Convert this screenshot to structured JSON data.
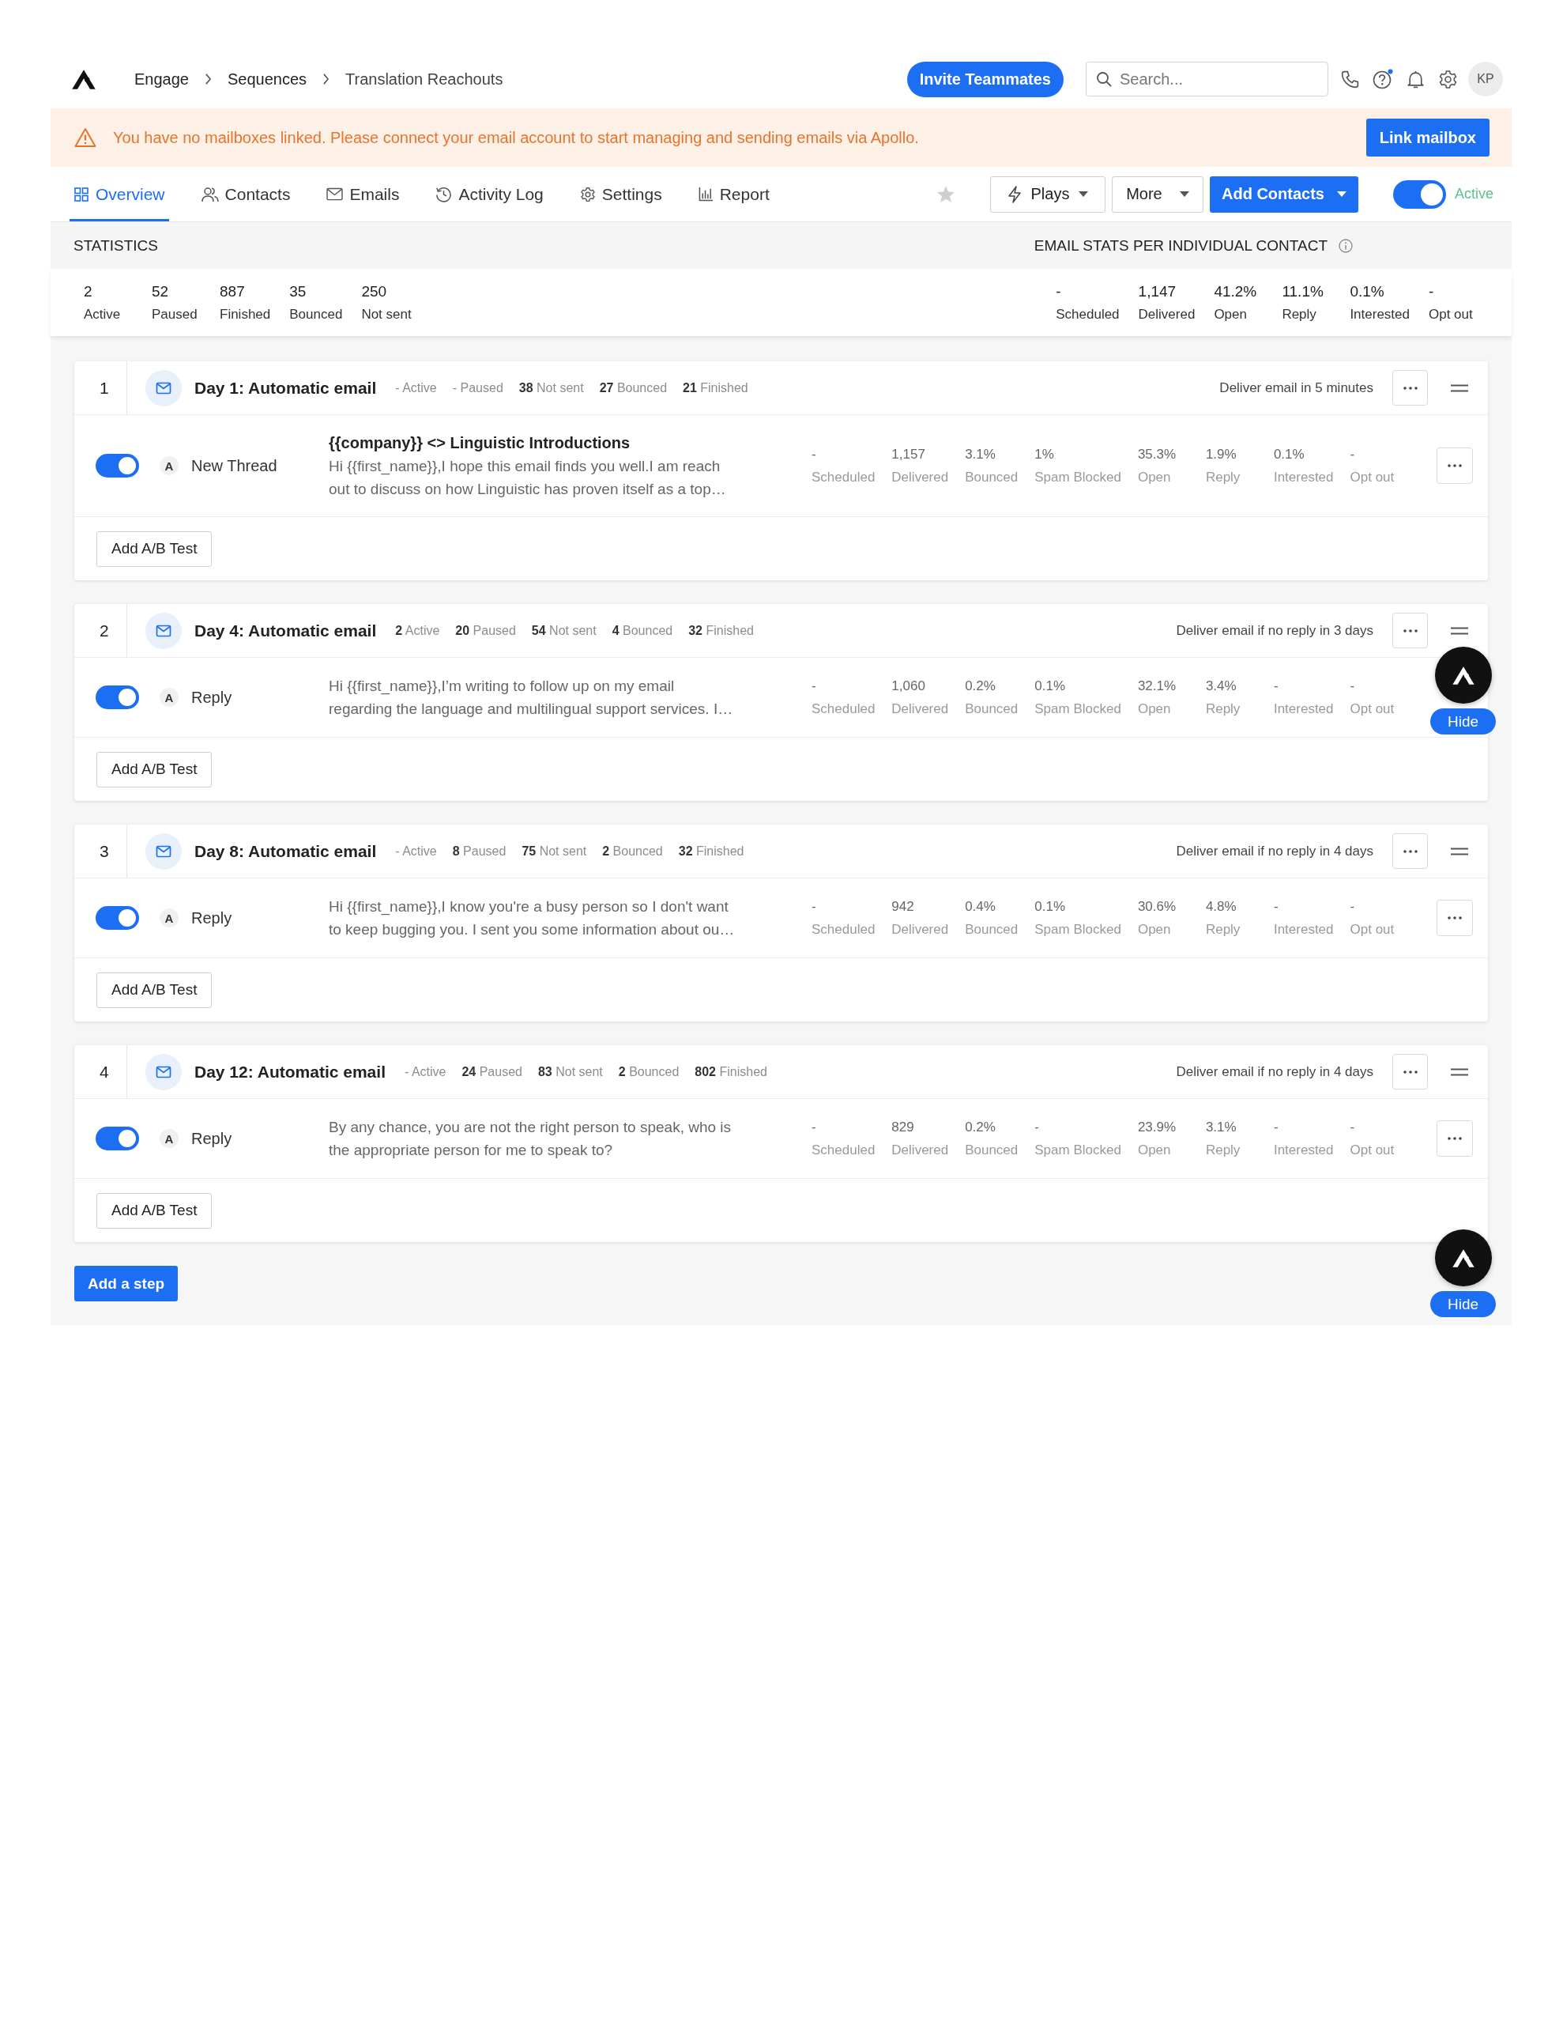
{
  "header": {
    "breadcrumbs": [
      "Engage",
      "Sequences",
      "Translation Reachouts"
    ],
    "invite_button": "Invite Teammates",
    "search": {
      "placeholder": "Search..."
    },
    "help_badge": true,
    "avatar": "KP"
  },
  "banner": {
    "message": "You have no mailboxes linked. Please connect your email account to start managing and sending emails via Apollo.",
    "button": "Link mailbox"
  },
  "tabs": [
    {
      "label": "Overview",
      "selected": true
    },
    {
      "label": "Contacts",
      "selected": false
    },
    {
      "label": "Emails",
      "selected": false
    },
    {
      "label": "Activity Log",
      "selected": false
    },
    {
      "label": "Settings",
      "selected": false
    },
    {
      "label": "Report",
      "selected": false
    }
  ],
  "toolbar": {
    "starred": false,
    "plays_button": "Plays",
    "more_button": "More",
    "add_contacts_button": "Add Contacts",
    "status": {
      "label": "Active",
      "on": true
    }
  },
  "statistics": {
    "title": "STATISTICS",
    "items": [
      {
        "value": "2",
        "label": "Active"
      },
      {
        "value": "52",
        "label": "Paused"
      },
      {
        "value": "887",
        "label": "Finished"
      },
      {
        "value": "35",
        "label": "Bounced"
      },
      {
        "value": "250",
        "label": "Not sent"
      }
    ]
  },
  "email_stats": {
    "title": "EMAIL STATS PER INDIVIDUAL CONTACT",
    "items": [
      {
        "value": "-",
        "label": "Scheduled"
      },
      {
        "value": "1,147",
        "label": "Delivered"
      },
      {
        "value": "41.2%",
        "label": "Open"
      },
      {
        "value": "11.1%",
        "label": "Reply"
      },
      {
        "value": "0.1%",
        "label": "Interested"
      },
      {
        "value": "-",
        "label": "Opt out"
      }
    ]
  },
  "steps": [
    {
      "number": "1",
      "title": "Day 1: Automatic email",
      "counts": [
        "- Active",
        "- Paused",
        "**38** Not sent",
        "**27** Bounced",
        "**21** Finished"
      ],
      "delivery": "Deliver email in 5 minutes",
      "variant": {
        "on": true,
        "letter": "A",
        "type": "New Thread",
        "subject": "{{company}} <> Linguistic Introductions",
        "preview": [
          "Hi {{first_name}},I hope this email finds you well.I am reach",
          "out to discuss on how Linguistic has proven itself as a top…"
        ],
        "stats": [
          {
            "value": "-",
            "label": "Scheduled"
          },
          {
            "value": "1,157",
            "label": "Delivered"
          },
          {
            "value": "3.1%",
            "label": "Bounced"
          },
          {
            "value": "1%",
            "label": "Spam Blocked"
          },
          {
            "value": "35.3%",
            "label": "Open"
          },
          {
            "value": "1.9%",
            "label": "Reply"
          },
          {
            "value": "0.1%",
            "label": "Interested"
          },
          {
            "value": "-",
            "label": "Opt out"
          }
        ],
        "menu_button": true
      },
      "ab_test_button": "Add A/B Test"
    },
    {
      "number": "2",
      "title": "Day 4: Automatic email",
      "counts": [
        "**2** Active",
        "**20** Paused",
        "**54** Not sent",
        "**4** Bounced",
        "**32** Finished"
      ],
      "delivery": "Deliver email if no reply in 3 days",
      "variant": {
        "on": true,
        "letter": "A",
        "type": "Reply",
        "preview": [
          "Hi {{first_name}},I’m writing to follow up on my email",
          "regarding the language and multilingual support services. I…"
        ],
        "stats": [
          {
            "value": "-",
            "label": "Scheduled"
          },
          {
            "value": "1,060",
            "label": "Delivered"
          },
          {
            "value": "0.2%",
            "label": "Bounced"
          },
          {
            "value": "0.1%",
            "label": "Spam Blocked"
          },
          {
            "value": "32.1%",
            "label": "Open"
          },
          {
            "value": "3.4%",
            "label": "Reply"
          },
          {
            "value": "-",
            "label": "Interested"
          },
          {
            "value": "-",
            "label": "Opt out"
          }
        ],
        "menu_button": false
      },
      "ab_test_button": "Add A/B Test"
    },
    {
      "number": "3",
      "title": "Day 8: Automatic email",
      "counts": [
        "- Active",
        "**8** Paused",
        "**75** Not sent",
        "**2** Bounced",
        "**32** Finished"
      ],
      "delivery": "Deliver email if no reply in 4 days",
      "variant": {
        "on": true,
        "letter": "A",
        "type": "Reply",
        "preview": [
          "Hi {{first_name}},I know you're a busy person so I don't want",
          "to keep bugging you. I sent you some information about ou…"
        ],
        "stats": [
          {
            "value": "-",
            "label": "Scheduled"
          },
          {
            "value": "942",
            "label": "Delivered"
          },
          {
            "value": "0.4%",
            "label": "Bounced"
          },
          {
            "value": "0.1%",
            "label": "Spam Blocked"
          },
          {
            "value": "30.6%",
            "label": "Open"
          },
          {
            "value": "4.8%",
            "label": "Reply"
          },
          {
            "value": "-",
            "label": "Interested"
          },
          {
            "value": "-",
            "label": "Opt out"
          }
        ],
        "menu_button": true
      },
      "ab_test_button": "Add A/B Test"
    },
    {
      "number": "4",
      "title": "Day 12: Automatic email",
      "counts": [
        "- Active",
        "**24** Paused",
        "**83** Not sent",
        "**2** Bounced",
        "**802** Finished"
      ],
      "delivery": "Deliver email if no reply in 4 days",
      "variant": {
        "on": true,
        "letter": "A",
        "type": "Reply",
        "preview": [
          "By any chance, you are not the right person to speak, who is",
          "the appropriate person for me to speak to?"
        ],
        "stats": [
          {
            "value": "-",
            "label": "Scheduled"
          },
          {
            "value": "829",
            "label": "Delivered"
          },
          {
            "value": "0.2%",
            "label": "Bounced"
          },
          {
            "value": "-",
            "label": "Spam Blocked"
          },
          {
            "value": "23.9%",
            "label": "Open"
          },
          {
            "value": "3.1%",
            "label": "Reply"
          },
          {
            "value": "-",
            "label": "Interested"
          },
          {
            "value": "-",
            "label": "Opt out"
          }
        ],
        "menu_button": true
      },
      "ab_test_button": "Add A/B Test"
    }
  ],
  "add_step_button": "Add a step",
  "assistant_widgets": [
    {
      "hide_button": "Hide"
    },
    {
      "hide_button": "Hide"
    }
  ]
}
